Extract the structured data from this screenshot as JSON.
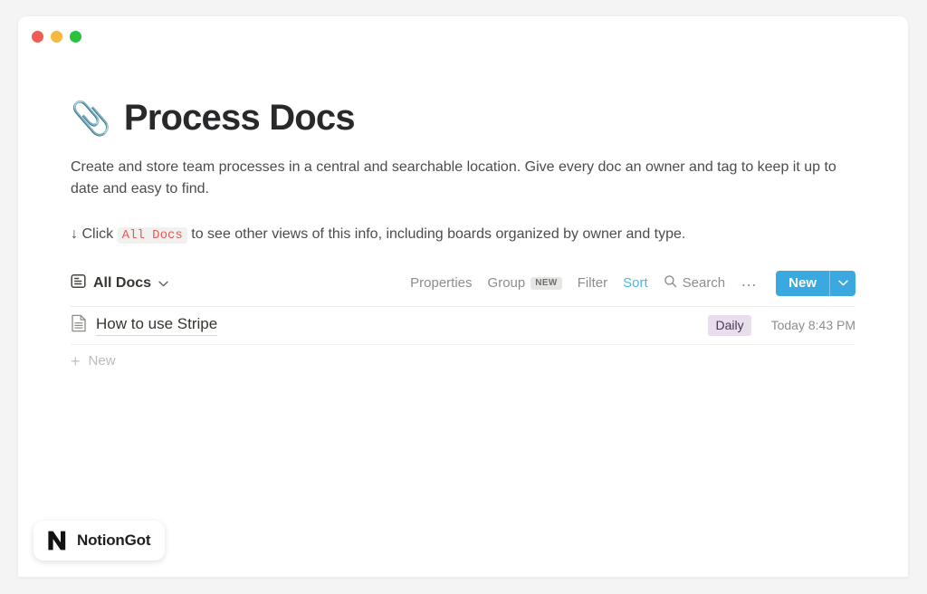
{
  "window": {
    "traffic_lights": [
      {
        "name": "close",
        "color": "#f05b56"
      },
      {
        "name": "minimize",
        "color": "#f6b93f"
      },
      {
        "name": "maximize",
        "color": "#28c23f"
      }
    ]
  },
  "page": {
    "emoji": "📎",
    "emoji_name": "paperclip",
    "title": "Process Docs",
    "description": "Create and store team processes in a central and searchable location. Give every doc an owner and tag to keep it up to date and easy to find.",
    "hint": {
      "arrow": "↓",
      "before": "Click",
      "code": "All Docs",
      "after": "to see other views of this info, including boards organized by owner and type."
    }
  },
  "toolbar": {
    "view_icon": "list-view-icon",
    "view_label": "All Docs",
    "view_caret": "⌄",
    "properties_label": "Properties",
    "group_label": "Group",
    "group_badge": "NEW",
    "filter_label": "Filter",
    "sort_label": "Sort",
    "search_label": "Search",
    "search_icon": "search-icon",
    "more_label": "…",
    "new_label": "New",
    "new_caret": "⌄",
    "accent_color": "#3aa9e0"
  },
  "database": {
    "rows": [
      {
        "icon": "document-icon",
        "title": "How to use Stripe",
        "tag": "Daily",
        "tag_color": "#e8deee",
        "time": "Today 8:43 PM"
      }
    ],
    "new_row_label": "New",
    "new_row_icon": "plus-icon"
  },
  "watermark": {
    "logo": "notion-n-logo",
    "text": "NotionGot"
  }
}
